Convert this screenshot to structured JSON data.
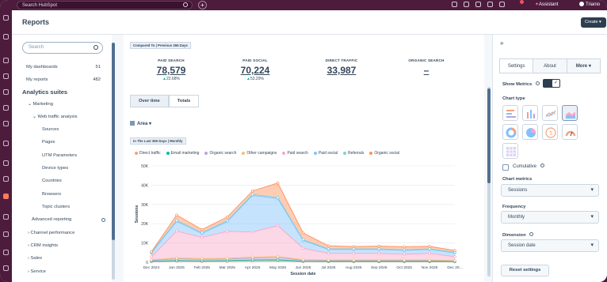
{
  "topbar": {
    "search_placeholder": "Search HubSpot",
    "assistant_label": "Assistant",
    "user_name": "Trianio"
  },
  "header": {
    "title": "Reports",
    "create_label": "Create ▾"
  },
  "leftnav": {
    "search_placeholder": "Search",
    "dashboards": {
      "label": "My dashboards",
      "count": "51"
    },
    "reports": {
      "label": "My reports",
      "count": "482"
    },
    "heading": "Analytics suites",
    "items": [
      {
        "label": "⌄  Marketing"
      },
      {
        "label": "⌄  Web traffic analysis"
      },
      {
        "label": "Sources"
      },
      {
        "label": "Pages"
      },
      {
        "label": "UTM Parameters"
      },
      {
        "label": "Device types"
      },
      {
        "label": "Countries"
      },
      {
        "label": "Browsers"
      },
      {
        "label": "Topic clusters"
      },
      {
        "label": "Advanced reporting"
      },
      {
        "label": "›  Channel performance"
      },
      {
        "label": "›  CRM insights"
      },
      {
        "label": "›  Sales"
      },
      {
        "label": "›  Service"
      }
    ]
  },
  "main": {
    "compared_badge": "Compared To | Previous 365 Days",
    "metrics": [
      {
        "label": "PAID SEARCH",
        "value": "78,579",
        "change": "22.68%"
      },
      {
        "label": "PAID SOCIAL",
        "value": "70,224",
        "change": "53.29%"
      },
      {
        "label": "DIRECT TRAFFIC",
        "value": "33,987",
        "change": ""
      },
      {
        "label": "ORGANIC SEARCH",
        "value": "–",
        "change": ""
      }
    ],
    "tabs": [
      "Over time",
      "Totals"
    ],
    "chart_type_dropdown": "Area",
    "range_badge": "In The Last 365 Days | Monthly"
  },
  "chart_data": {
    "type": "area",
    "stacked": true,
    "xlabel": "Session date",
    "ylabel": "Sessions",
    "ylim": [
      0,
      50000
    ],
    "yticks": [
      "0",
      "10K",
      "20K",
      "30K",
      "40K",
      "50K"
    ],
    "categories": [
      "Dec 2024",
      "Jan 2025",
      "Feb 2025",
      "Mar 2025",
      "Apr 2025",
      "May 2025",
      "Jun 2025",
      "Jul 2025",
      "Aug 2025",
      "Sep 2025",
      "Oct 2025",
      "Nov 2025",
      "Dec 20..."
    ],
    "legend_position": "top",
    "series": [
      {
        "name": "Direct traffic",
        "color": "#f5a27a",
        "values": [
          300,
          500,
          400,
          450,
          600,
          700,
          300,
          250,
          250,
          250,
          250,
          250,
          250
        ]
      },
      {
        "name": "Email marketing",
        "color": "#00bda5",
        "values": [
          200,
          400,
          300,
          400,
          600,
          600,
          200,
          200,
          200,
          200,
          200,
          200,
          150
        ]
      },
      {
        "name": "Organic search",
        "color": "#b9a3e3",
        "values": [
          500,
          900,
          800,
          800,
          1000,
          1200,
          500,
          400,
          400,
          400,
          400,
          400,
          300
        ]
      },
      {
        "name": "Other campaigns",
        "color": "#f5c26b",
        "values": [
          300,
          400,
          400,
          400,
          500,
          500,
          300,
          300,
          300,
          300,
          300,
          300,
          200
        ]
      },
      {
        "name": "Paid search",
        "color": "#f8a6c8",
        "values": [
          1500,
          14000,
          11000,
          14000,
          13000,
          16000,
          6000,
          3500,
          3500,
          3500,
          3000,
          3500,
          2000
        ]
      },
      {
        "name": "Paid social",
        "color": "#81c1fd",
        "values": [
          2000,
          5000,
          2000,
          5000,
          19000,
          14000,
          4000,
          2000,
          2000,
          2000,
          2000,
          2000,
          2000
        ]
      },
      {
        "name": "Referrals",
        "color": "#7fd1de",
        "values": [
          300,
          500,
          500,
          500,
          500,
          600,
          400,
          300,
          300,
          300,
          300,
          300,
          300
        ]
      },
      {
        "name": "Organic social",
        "color": "#ff8f59",
        "values": [
          300,
          2800,
          1600,
          1900,
          1800,
          7500,
          3500,
          1600,
          1200,
          1400,
          1600,
          1300,
          900
        ]
      }
    ]
  },
  "rpanel": {
    "tabs": [
      "Settings",
      "About",
      "More ▾"
    ],
    "show_metrics_label": "Show Metrics",
    "chart_type_label": "Chart type",
    "cumulative_label": "Cumulative",
    "chart_metrics_label": "Chart metrics",
    "chart_metrics_value": "Sessions",
    "frequency_label": "Frequency",
    "frequency_value": "Monthly",
    "dimension_label": "Dimension",
    "dimension_value": "Session date",
    "reset_label": "Reset settings"
  }
}
